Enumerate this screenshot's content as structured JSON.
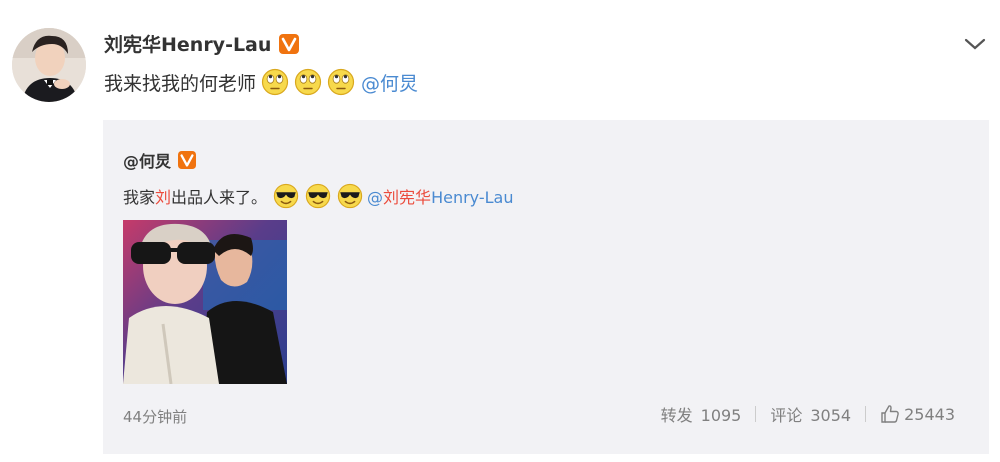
{
  "post": {
    "author_name": "刘宪华Henry-Lau",
    "text": "我来找我的何老师",
    "emojis": [
      "rolling-eyes-emoji",
      "rolling-eyes-emoji",
      "rolling-eyes-emoji"
    ],
    "mention": "@何炅"
  },
  "repost": {
    "author": "@何炅",
    "text_before": "我家",
    "text_highlight": "刘",
    "text_after": "出品人来了。",
    "emojis": [
      "sunglasses-emoji",
      "sunglasses-emoji",
      "sunglasses-emoji"
    ],
    "mention_prefix": "@",
    "mention_highlight": "刘宪华",
    "mention_rest": "Henry-Lau",
    "timestamp": "44分钟前",
    "actions": {
      "repost_label": "转发",
      "repost_count": "1095",
      "comment_label": "评论",
      "comment_count": "3054",
      "like_count": "25443"
    }
  },
  "colors": {
    "link": "#4a8ad1",
    "highlight": "#eb4b3c",
    "repost_bg": "#f2f2f5",
    "muted": "#808080",
    "verified_badge": "#f0730f"
  },
  "icons": [
    "verified-v-badge-icon",
    "chevron-down-icon",
    "thumbs-up-icon"
  ]
}
